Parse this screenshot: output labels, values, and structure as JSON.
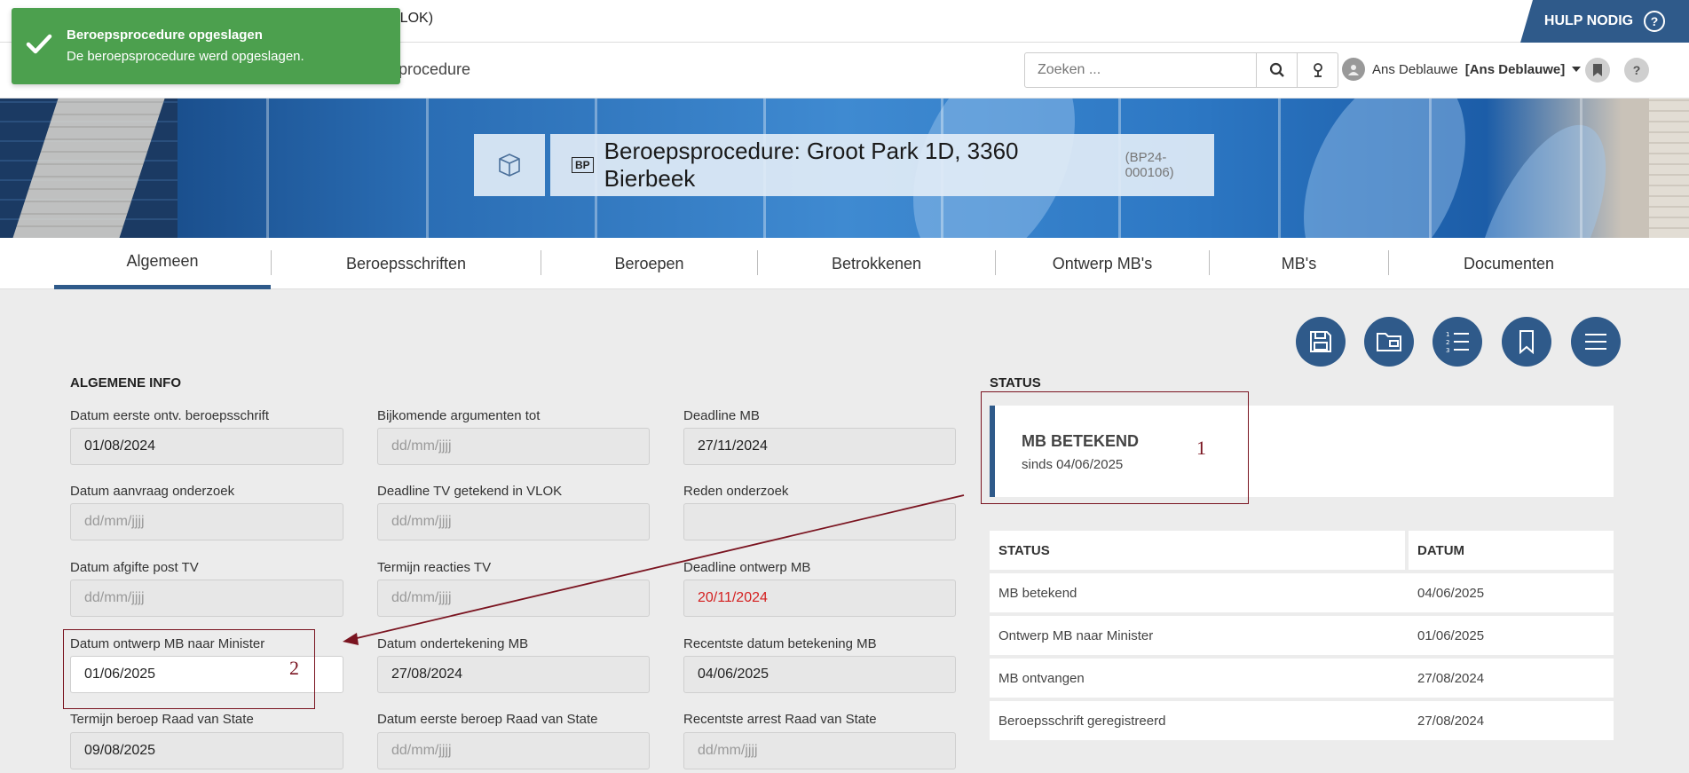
{
  "topbar": {
    "app_title": "VLOK)",
    "help_label": "HULP NODIG",
    "help_icon": "?"
  },
  "subbar": {
    "crumb": "sprocedure",
    "search": {
      "placeholder": "Zoeken ..."
    },
    "user_name": "Ans Deblauwe",
    "user_name_bold": "[Ans Deblauwe]",
    "help_small": "?"
  },
  "toast": {
    "title": "Beroepsprocedure opgeslagen",
    "message": "De beroepsprocedure werd opgeslagen."
  },
  "header": {
    "badge": "BP",
    "title": "Beroepsprocedure: Groot Park 1D, 3360 Bierbeek",
    "code": "(BP24-000106)"
  },
  "tabs": [
    {
      "label": "Algemeen"
    },
    {
      "label": "Beroepsschriften"
    },
    {
      "label": "Beroepen"
    },
    {
      "label": "Betrokkenen"
    },
    {
      "label": "Ontwerp MB's"
    },
    {
      "label": "MB's"
    },
    {
      "label": "Documenten"
    }
  ],
  "general": {
    "heading": "ALGEMENE INFO",
    "fields": [
      {
        "label": "Datum eerste ontv. beroepsschrift",
        "value": "01/08/2024"
      },
      {
        "label": "Bijkomende argumenten tot",
        "value": "dd/mm/jjjj"
      },
      {
        "label": "Deadline MB",
        "value": "27/11/2024"
      },
      {
        "label": "Datum aanvraag onderzoek",
        "value": "dd/mm/jjjj"
      },
      {
        "label": "Deadline TV getekend in VLOK",
        "value": "dd/mm/jjjj"
      },
      {
        "label": "Reden onderzoek",
        "value": ""
      },
      {
        "label": "Datum afgifte post TV",
        "value": "dd/mm/jjjj"
      },
      {
        "label": "Termijn reacties TV",
        "value": "dd/mm/jjjj"
      },
      {
        "label": "Deadline ontwerp MB",
        "value": "20/11/2024"
      },
      {
        "label": "Datum ontwerp MB naar Minister",
        "value": "01/06/2025"
      },
      {
        "label": "Datum ondertekening MB",
        "value": "27/08/2024"
      },
      {
        "label": "Recentste datum betekening MB",
        "value": "04/06/2025"
      },
      {
        "label": "Termijn beroep Raad van State",
        "value": "09/08/2025"
      },
      {
        "label": "Datum eerste beroep Raad van State",
        "value": "dd/mm/jjjj"
      },
      {
        "label": "Recentste arrest Raad van State",
        "value": "dd/mm/jjjj"
      }
    ]
  },
  "status": {
    "heading": "STATUS",
    "current": "MB BETEKEND",
    "since": "sinds 04/06/2025",
    "table": {
      "headers": [
        "STATUS",
        "DATUM"
      ],
      "rows": [
        [
          "MB betekend",
          "04/06/2025"
        ],
        [
          "Ontwerp MB naar Minister",
          "01/06/2025"
        ],
        [
          "MB ontvangen",
          "27/08/2024"
        ],
        [
          "Beroepsschrift geregistreerd",
          "27/08/2024"
        ]
      ]
    }
  },
  "annotations": {
    "one": "1",
    "two": "2"
  },
  "colors": {
    "primary": "#2f5a8a",
    "toast": "#4ca04e",
    "annotation": "#7a1420",
    "deadline_red": "#d42020"
  }
}
